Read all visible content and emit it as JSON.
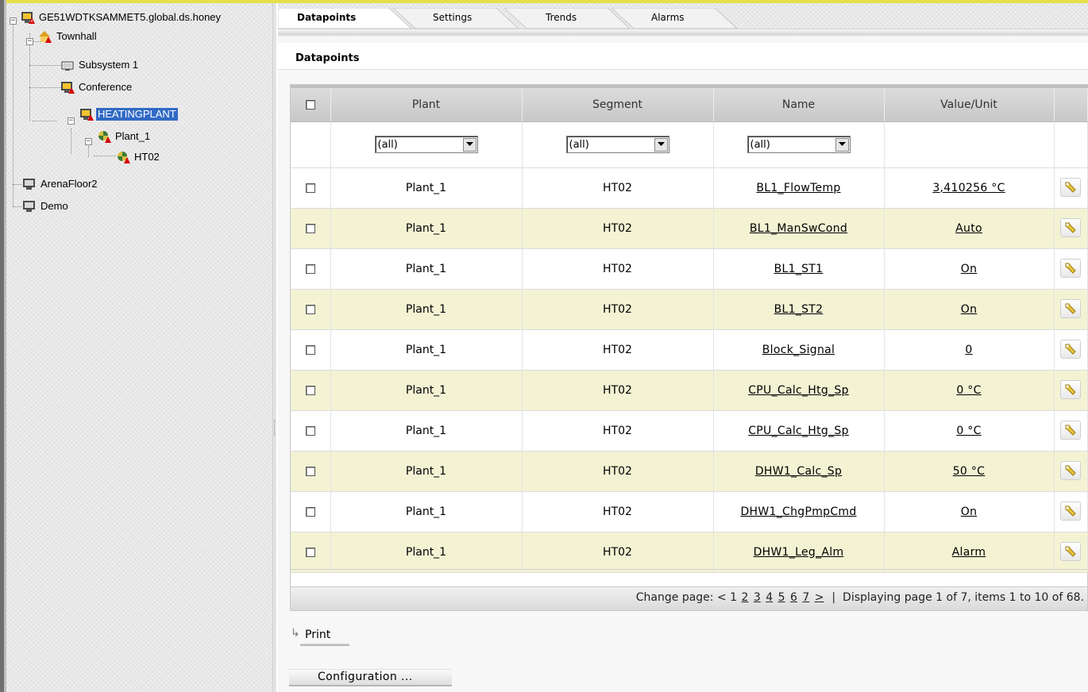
{
  "tree": {
    "root": "GE51WDTKSAMMET5.global.ds.honey",
    "townhall": "Townhall",
    "subsystem": "Subsystem 1",
    "conference": "Conference",
    "heatingplant": "HEATINGPLANT",
    "plant": "Plant_1",
    "ht02": "HT02",
    "arena": "ArenaFloor2",
    "demo": "Demo",
    "expand_collapsed_glyph": "−"
  },
  "tabs": [
    {
      "label": "Datapoints",
      "active": true
    },
    {
      "label": "Settings",
      "active": false
    },
    {
      "label": "Trends",
      "active": false
    },
    {
      "label": "Alarms",
      "active": false
    }
  ],
  "section_title": "Datapoints",
  "grid": {
    "columns": [
      "Plant",
      "Segment",
      "Name",
      "Value/Unit"
    ],
    "filters": [
      "(all)",
      "(all)",
      "(all)"
    ],
    "rows": [
      {
        "plant": "Plant_1",
        "segment": "HT02",
        "name": "BL1_FlowTemp",
        "value": "3,410256 °C"
      },
      {
        "plant": "Plant_1",
        "segment": "HT02",
        "name": "BL1_ManSwCond",
        "value": "Auto"
      },
      {
        "plant": "Plant_1",
        "segment": "HT02",
        "name": "BL1_ST1",
        "value": "On"
      },
      {
        "plant": "Plant_1",
        "segment": "HT02",
        "name": "BL1_ST2",
        "value": "On"
      },
      {
        "plant": "Plant_1",
        "segment": "HT02",
        "name": "Block_Signal",
        "value": "0"
      },
      {
        "plant": "Plant_1",
        "segment": "HT02",
        "name": "CPU_Calc_Htg_Sp",
        "value": "0 °C"
      },
      {
        "plant": "Plant_1",
        "segment": "HT02",
        "name": "CPU_Calc_Htg_Sp",
        "value": "0 °C"
      },
      {
        "plant": "Plant_1",
        "segment": "HT02",
        "name": "DHW1_Calc_Sp",
        "value": "50 °C"
      },
      {
        "plant": "Plant_1",
        "segment": "HT02",
        "name": "DHW1_ChgPmpCmd",
        "value": "On"
      },
      {
        "plant": "Plant_1",
        "segment": "HT02",
        "name": "DHW1_Leg_Alm",
        "value": "Alarm"
      }
    ]
  },
  "pager": {
    "label": "Change page:",
    "prev": "<",
    "current": "1",
    "pages": [
      "2",
      "3",
      "4",
      "5",
      "6",
      "7"
    ],
    "next": ">",
    "separator": "|",
    "status": "Displaying page 1 of 7, items 1 to 10 of 68."
  },
  "buttons": {
    "print": "Print",
    "print_arrow": "↳",
    "configuration": "Configuration ..."
  },
  "icons": {
    "tree_monitor_alarm": "monitor-alarm-icon",
    "tree_house_alarm": "house-alarm-icon",
    "tree_plant_alarm": "plant-alarm-icon",
    "edit": "wrench-icon"
  },
  "colors": {
    "accent_top": "#e5e04a",
    "selected": "#316ac5",
    "row_alt": "#f3f3d4"
  }
}
